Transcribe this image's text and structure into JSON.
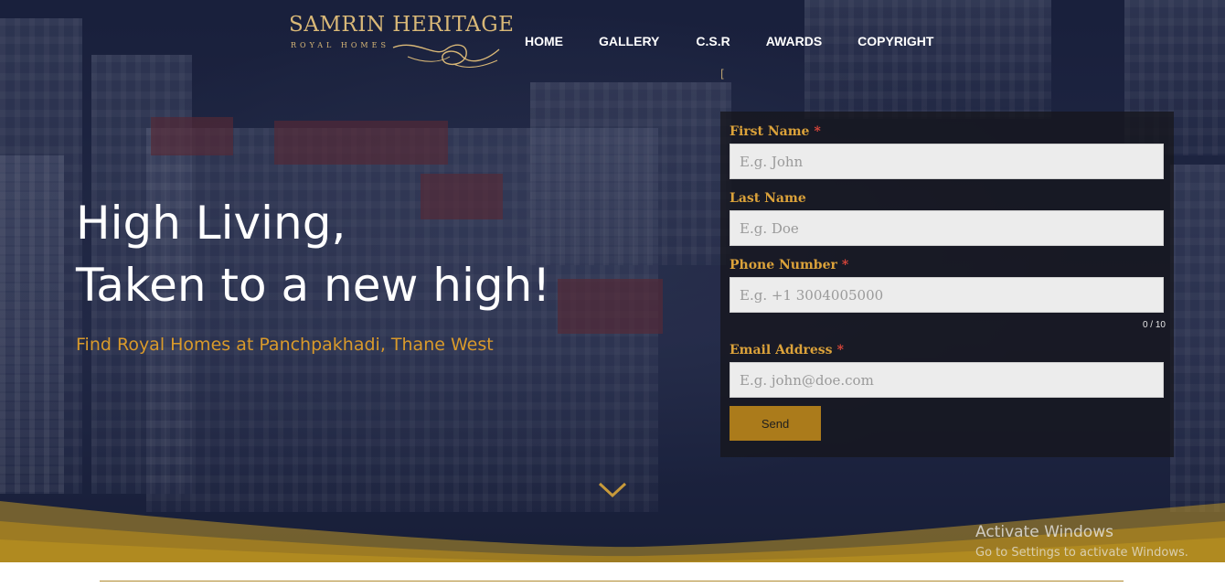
{
  "brand": {
    "name": "SAMRIN HERITAGE",
    "tagline": "ROYAL HOMES"
  },
  "nav": {
    "items": [
      {
        "label": "HOME"
      },
      {
        "label": "GALLERY"
      },
      {
        "label": "C.S.R"
      },
      {
        "label": "AWARDS"
      },
      {
        "label": "COPYRIGHT"
      }
    ]
  },
  "hero": {
    "headline_line1": "High Living,",
    "headline_line2": "Taken to a new high!",
    "subheadline": "Find Royal Homes at Panchpakhadi, Thane West",
    "stray_char": "["
  },
  "form": {
    "first_name": {
      "label": "First Name",
      "required": "*",
      "placeholder": "E.g. John",
      "value": ""
    },
    "last_name": {
      "label": "Last Name",
      "placeholder": "E.g. Doe",
      "value": ""
    },
    "phone": {
      "label": "Phone Number",
      "required": "*",
      "placeholder": "E.g. +1 3004005000",
      "value": "",
      "counter": "0 / 10"
    },
    "email": {
      "label": "Email Address",
      "required": "*",
      "placeholder": "E.g. john@doe.com",
      "value": ""
    },
    "submit_label": "Send"
  },
  "watermark": {
    "title": "Activate Windows",
    "subtitle": "Go to Settings to activate Windows."
  },
  "colors": {
    "accent_gold": "#ab7b1b",
    "label_gold": "#dba23a",
    "subheadline_orange": "#d99a2b",
    "required_red": "#e0473b",
    "hero_navy": "#252c4a"
  },
  "icons": {
    "scroll_down": "chevron-down-icon",
    "logo_flourish": "logo-flourish-icon"
  }
}
